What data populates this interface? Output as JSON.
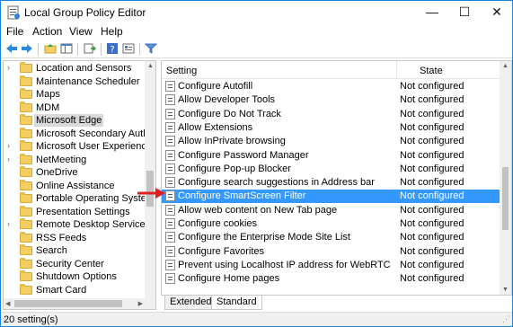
{
  "window": {
    "title": "Local Group Policy Editor",
    "minimize": "—",
    "maximize": "☐",
    "close": "✕"
  },
  "menu": [
    "File",
    "Action",
    "View",
    "Help"
  ],
  "toolbar": {
    "icons": [
      "back-icon",
      "forward-icon",
      "up-folder-icon",
      "show-hide-tree-icon",
      "export-list-icon",
      "help-icon",
      "properties-icon",
      "filter-icon"
    ]
  },
  "tree": {
    "items": [
      {
        "label": "Location and Sensors",
        "expandable": true,
        "selected": false
      },
      {
        "label": "Maintenance Scheduler",
        "expandable": false,
        "selected": false
      },
      {
        "label": "Maps",
        "expandable": false,
        "selected": false
      },
      {
        "label": "MDM",
        "expandable": false,
        "selected": false
      },
      {
        "label": "Microsoft Edge",
        "expandable": false,
        "selected": true
      },
      {
        "label": "Microsoft Secondary Authent",
        "expandable": false,
        "selected": false
      },
      {
        "label": "Microsoft User Experience Vir",
        "expandable": true,
        "selected": false
      },
      {
        "label": "NetMeeting",
        "expandable": true,
        "selected": false
      },
      {
        "label": "OneDrive",
        "expandable": false,
        "selected": false
      },
      {
        "label": "Online Assistance",
        "expandable": false,
        "selected": false
      },
      {
        "label": "Portable Operating System",
        "expandable": false,
        "selected": false
      },
      {
        "label": "Presentation Settings",
        "expandable": false,
        "selected": false
      },
      {
        "label": "Remote Desktop Services",
        "expandable": true,
        "selected": false
      },
      {
        "label": "RSS Feeds",
        "expandable": false,
        "selected": false
      },
      {
        "label": "Search",
        "expandable": false,
        "selected": false
      },
      {
        "label": "Security Center",
        "expandable": false,
        "selected": false
      },
      {
        "label": "Shutdown Options",
        "expandable": false,
        "selected": false
      },
      {
        "label": "Smart Card",
        "expandable": false,
        "selected": false
      }
    ]
  },
  "list": {
    "headers": {
      "setting": "Setting",
      "state": "State"
    },
    "rows": [
      {
        "name": "Configure Autofill",
        "state": "Not configured",
        "selected": false
      },
      {
        "name": "Allow Developer Tools",
        "state": "Not configured",
        "selected": false
      },
      {
        "name": "Configure Do Not Track",
        "state": "Not configured",
        "selected": false
      },
      {
        "name": "Allow Extensions",
        "state": "Not configured",
        "selected": false
      },
      {
        "name": "Allow InPrivate browsing",
        "state": "Not configured",
        "selected": false
      },
      {
        "name": "Configure Password Manager",
        "state": "Not configured",
        "selected": false
      },
      {
        "name": "Configure Pop-up Blocker",
        "state": "Not configured",
        "selected": false
      },
      {
        "name": "Configure search suggestions in Address bar",
        "state": "Not configured",
        "selected": false
      },
      {
        "name": "Configure SmartScreen Filter",
        "state": "Not configured",
        "selected": true
      },
      {
        "name": "Allow web content on New Tab page",
        "state": "Not configured",
        "selected": false
      },
      {
        "name": "Configure cookies",
        "state": "Not configured",
        "selected": false
      },
      {
        "name": "Configure the Enterprise Mode Site List",
        "state": "Not configured",
        "selected": false
      },
      {
        "name": "Configure Favorites",
        "state": "Not configured",
        "selected": false
      },
      {
        "name": "Prevent using Localhost IP address for WebRTC",
        "state": "Not configured",
        "selected": false
      },
      {
        "name": "Configure Home pages",
        "state": "Not configured",
        "selected": false
      }
    ]
  },
  "tabs": [
    {
      "label": "Extended",
      "active": false
    },
    {
      "label": "Standard",
      "active": true
    }
  ],
  "status": {
    "text": "20 setting(s)"
  },
  "colors": {
    "selection": "#3399ff",
    "annotation_arrow": "#e02020"
  }
}
